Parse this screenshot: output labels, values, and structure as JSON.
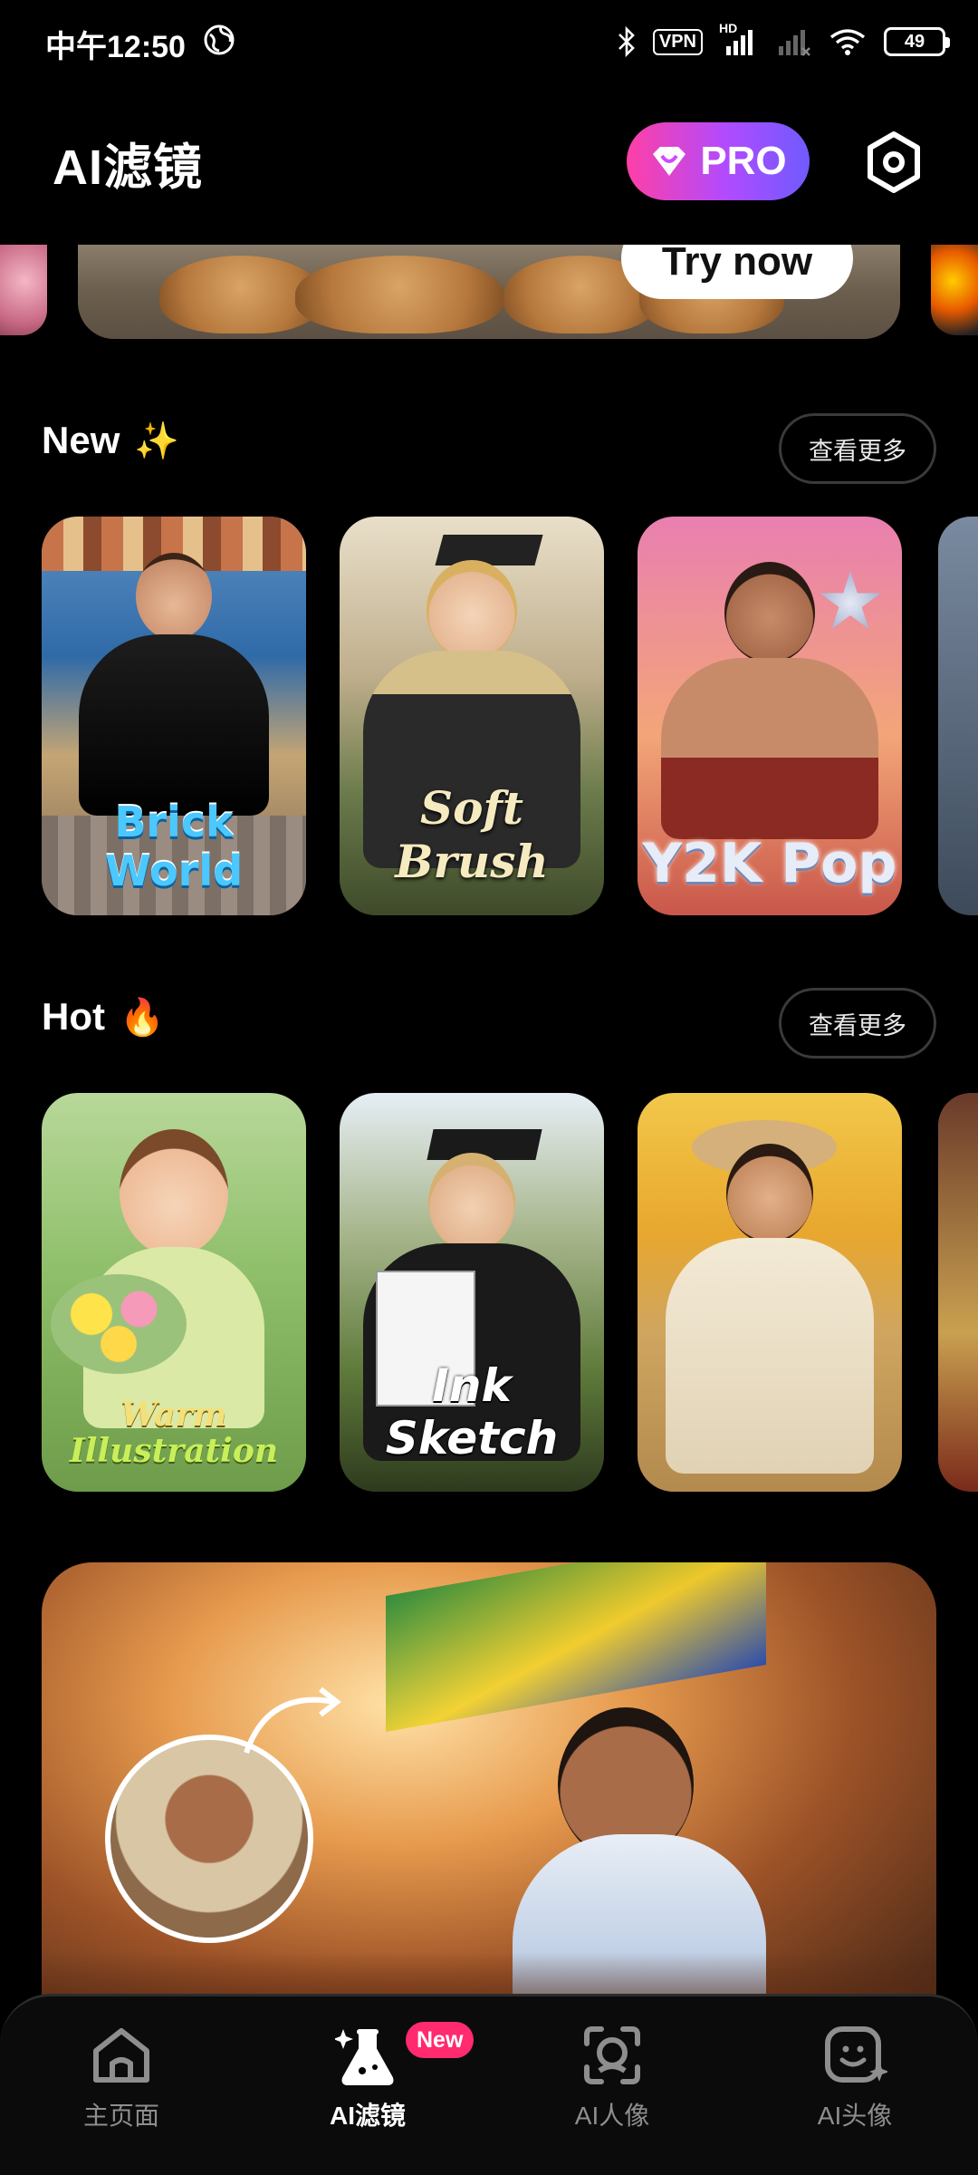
{
  "status_bar": {
    "time": "中午12:50",
    "vpn": "VPN",
    "hd": "HD",
    "battery": "49"
  },
  "header": {
    "title": "AI滤镜",
    "pro_label": "PRO"
  },
  "banner": {
    "cta": "Try now"
  },
  "sections": {
    "new": {
      "title": "New",
      "emoji": "✨",
      "more_label": "查看更多",
      "cards": [
        {
          "label": "Brick World"
        },
        {
          "label": "Soft Brush"
        },
        {
          "label": "Y2K Pop"
        }
      ]
    },
    "hot": {
      "title": "Hot",
      "emoji": "🔥",
      "more_label": "查看更多",
      "cards": [
        {
          "label_line1": "Warm",
          "label_line2": "Illustration"
        },
        {
          "label": "Ink Sketch"
        },
        {
          "label": ""
        }
      ]
    }
  },
  "bottom_nav": {
    "items": [
      {
        "label": "主页面",
        "icon": "home-icon"
      },
      {
        "label": "AI滤镜",
        "icon": "flask-icon",
        "active": true
      },
      {
        "label": "AI人像",
        "icon": "face-scan-icon"
      },
      {
        "label": "AI头像",
        "icon": "avatar-sparkle-icon"
      }
    ],
    "new_badge": "New"
  },
  "colors": {
    "accent_gradient_start": "#ff3fa6",
    "accent_gradient_end": "#6f5bff",
    "badge": "#ff2b6e"
  }
}
